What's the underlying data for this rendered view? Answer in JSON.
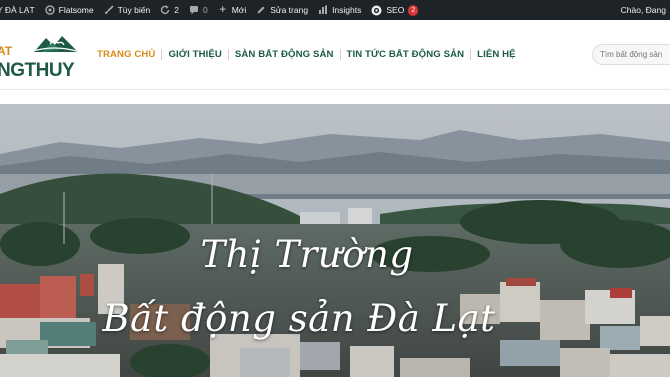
{
  "adminbar": {
    "site_name": "Y ĐÀ LẠT",
    "theme": "Flatsome",
    "customize": "Tùy biến",
    "updates_count": "2",
    "comments_count": "0",
    "new": "Mới",
    "edit_page": "Sửa trang",
    "insights": "Insights",
    "seo": "SEO",
    "seo_count": "2",
    "greeting": "Chào, Đang"
  },
  "logo": {
    "text_top": "AT",
    "text_main": "NGTHUY"
  },
  "nav": {
    "items": [
      {
        "label": "TRANG CHỦ",
        "active": true
      },
      {
        "label": "GIỚI THIỆU",
        "active": false
      },
      {
        "label": "SÀN BẤT ĐỘNG SẢN",
        "active": false
      },
      {
        "label": "TIN TỨC BẤT ĐỘNG SẢN",
        "active": false
      },
      {
        "label": "LIÊN HỆ",
        "active": false
      }
    ]
  },
  "search": {
    "placeholder": "Tìm bất động sản"
  },
  "hero": {
    "line1": "Thị Trường",
    "line2": "Bất động sản Đà Lạt"
  },
  "colors": {
    "adminbar_bg": "#1d2327",
    "nav_text": "#1a5a4a",
    "nav_active": "#d98a1b",
    "badge": "#d63638"
  },
  "icons": {
    "theme": "paint-brush-icon",
    "customize": "brush-icon",
    "updates": "refresh-icon",
    "comments": "comment-icon",
    "new": "plus-icon",
    "edit": "pencil-icon",
    "insights": "bar-chart-icon",
    "seo": "seo-gear-icon"
  }
}
